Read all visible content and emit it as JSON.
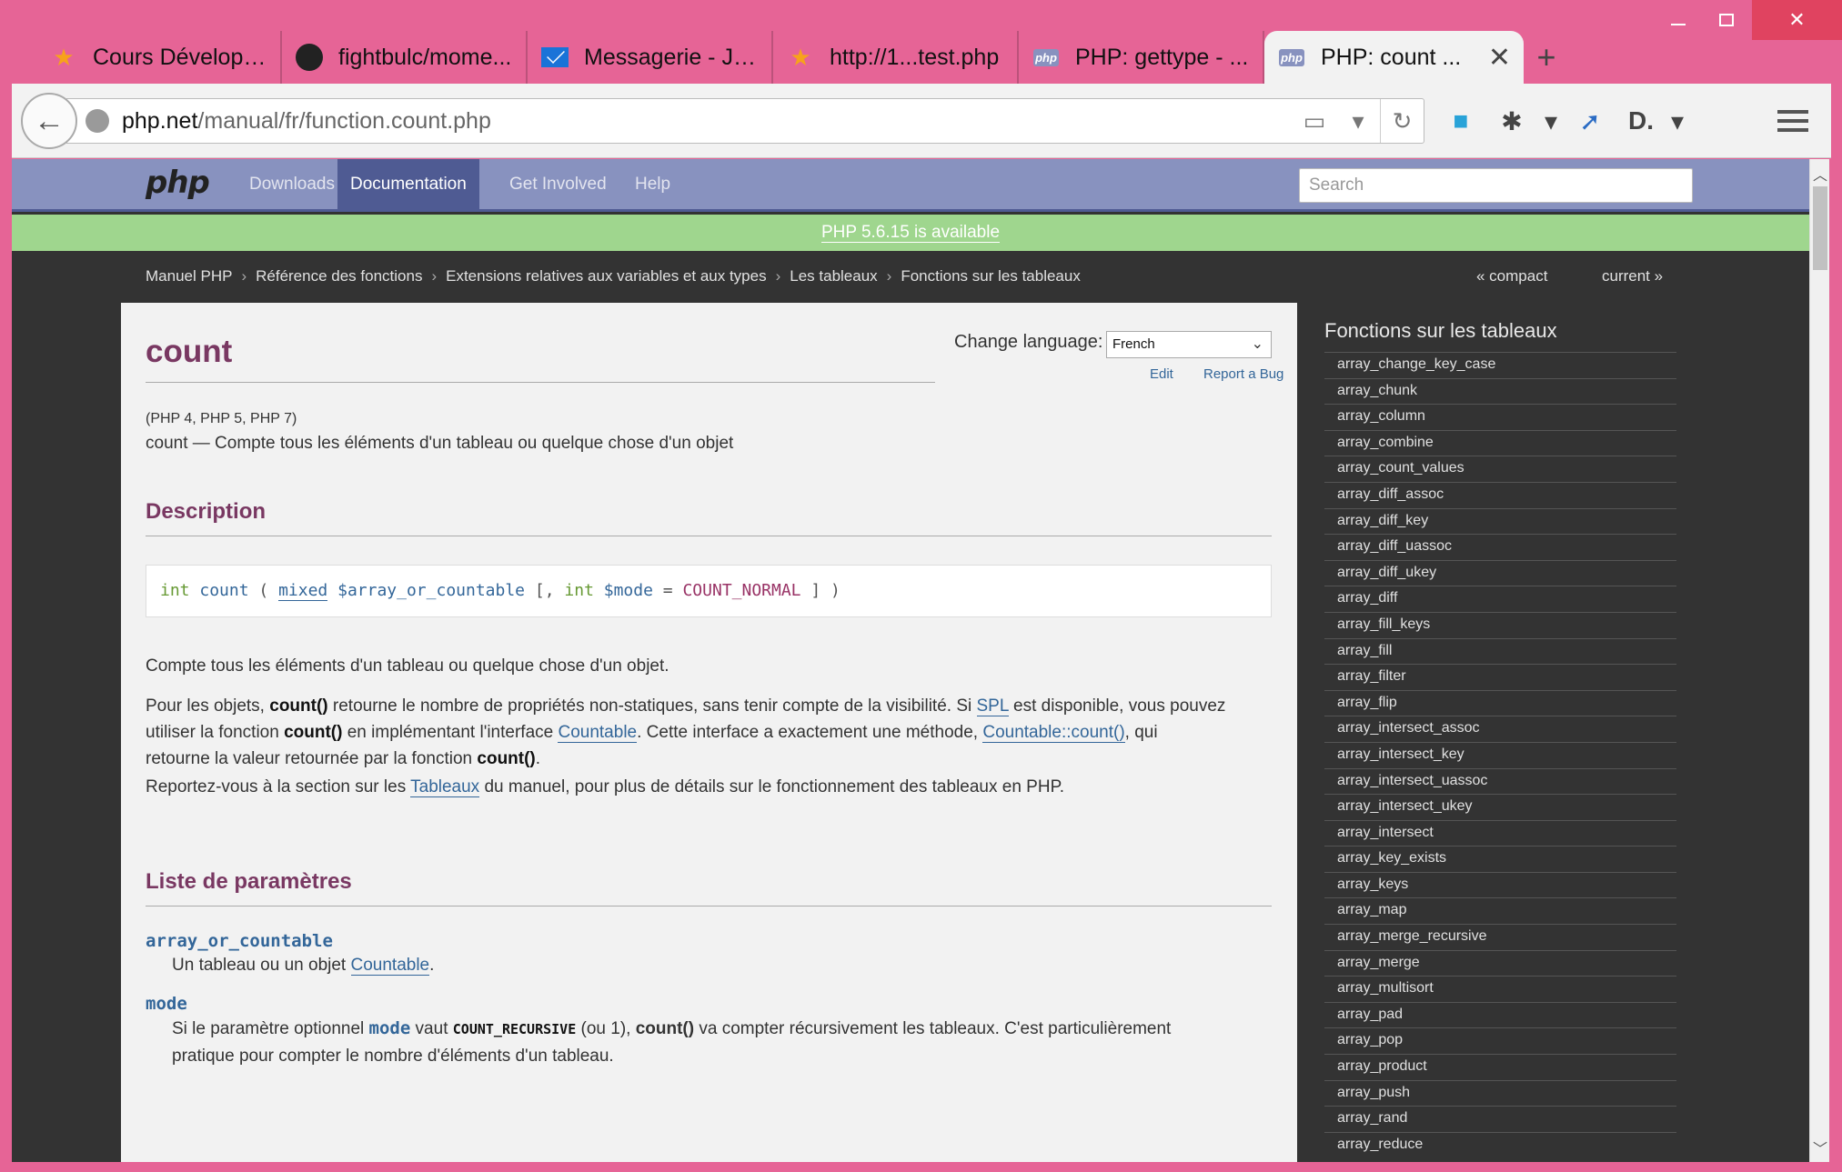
{
  "window": {
    "controls": {
      "minimize": "–",
      "maximize": "",
      "close": "✕"
    }
  },
  "tabs": [
    {
      "label": "Cours Développ...",
      "icon": "star-icon"
    },
    {
      "label": "fightbulc/mome...",
      "icon": "github-icon"
    },
    {
      "label": "Messagerie - Je...",
      "icon": "mail-icon"
    },
    {
      "label": "http://1...test.php",
      "icon": "star-icon"
    },
    {
      "label": "PHP: gettype - ...",
      "icon": "php-icon"
    },
    {
      "label": "PHP: count ...",
      "icon": "php-icon",
      "active": true
    }
  ],
  "new_tab": "+",
  "toolbar": {
    "url_host": "php.net",
    "url_path": "/manual/fr/function.count.php"
  },
  "php_site": {
    "logo": "php",
    "nav": [
      "Downloads",
      "Documentation",
      "Get Involved",
      "Help"
    ],
    "active_nav": "Documentation",
    "search_placeholder": "Search",
    "banner": "PHP 5.6.15 is available",
    "breadcrumbs": [
      "Manuel PHP",
      "Référence des fonctions",
      "Extensions relatives aux variables et aux types",
      "Les tableaux",
      "Fonctions sur les tableaux"
    ],
    "breadcrumb_sep": "›",
    "pager_prev": "« compact",
    "pager_next": "current »"
  },
  "content": {
    "title": "count",
    "change_language_label": "Change language:",
    "language_selected": "French",
    "edit_link": "Edit",
    "report_bug_link": "Report a Bug",
    "versions": "(PHP 4, PHP 5, PHP 7)",
    "refpurpose": "count — Compte tous les éléments d'un tableau ou quelque chose d'un objet",
    "description_heading": "Description",
    "synopsis": {
      "return_type": "int",
      "func": "count",
      "open": "(",
      "param1_type": "mixed",
      "param1_name": "$array_or_countable",
      "opt_open": "[,",
      "param2_type": "int",
      "param2_name": "$mode",
      "equals": "=",
      "param2_default": "COUNT_NORMAL",
      "close": "] )"
    },
    "desc_p1": "Compte tous les éléments d'un tableau ou quelque chose d'un objet.",
    "desc_p2": {
      "t1": "Pour les objets, ",
      "b1": "count()",
      "t2": " retourne le nombre de propriétés non-statiques, sans tenir compte de la visibilité. Si ",
      "l1": "SPL",
      "t3": " est disponible, vous pouvez",
      "t4": "utiliser la fonction ",
      "b2": "count()",
      "t5": " en implémentant l'interface ",
      "l2": "Countable",
      "t6": ". Cette interface a exactement une méthode, ",
      "l3": "Countable::count()",
      "t7": ", qui",
      "t8": "retourne la valeur retournée par la fonction ",
      "b3": "count()",
      "t9": "."
    },
    "desc_p3": {
      "t1": "Reportez-vous à la section sur les ",
      "l1": "Tableaux",
      "t2": " du manuel, pour plus de détails sur le fonctionnement des tableaux en PHP."
    },
    "params_heading": "Liste de paramètres",
    "param1": {
      "name": "array_or_countable",
      "t1": "Un tableau ou un objet ",
      "l1": "Countable",
      "t2": "."
    },
    "param2": {
      "name": "mode",
      "t1": "Si le paramètre optionnel ",
      "m1": "mode",
      "t2": " vaut ",
      "c1": "COUNT_RECURSIVE",
      "t3": " (ou 1), ",
      "b1": "count()",
      "t4": " va compter récursivement les tableaux. C'est particulièrement",
      "t5": "pratique pour compter le nombre d'éléments d'un tableau."
    }
  },
  "sidebar": {
    "title": "Fonctions sur les tableaux",
    "items": [
      "array_change_key_case",
      "array_chunk",
      "array_column",
      "array_combine",
      "array_count_values",
      "array_diff_assoc",
      "array_diff_key",
      "array_diff_uassoc",
      "array_diff_ukey",
      "array_diff",
      "array_fill_keys",
      "array_fill",
      "array_filter",
      "array_flip",
      "array_intersect_assoc",
      "array_intersect_key",
      "array_intersect_uassoc",
      "array_intersect_ukey",
      "array_intersect",
      "array_key_exists",
      "array_keys",
      "array_map",
      "array_merge_recursive",
      "array_merge",
      "array_multisort",
      "array_pad",
      "array_pop",
      "array_product",
      "array_push",
      "array_rand",
      "array_reduce"
    ]
  },
  "colors": {
    "window_frame": "#e66496",
    "php_nav": "#8892bf",
    "php_nav_active": "#4f5b93",
    "banner": "#9fd68e",
    "heading": "#793862",
    "link": "#336699"
  }
}
